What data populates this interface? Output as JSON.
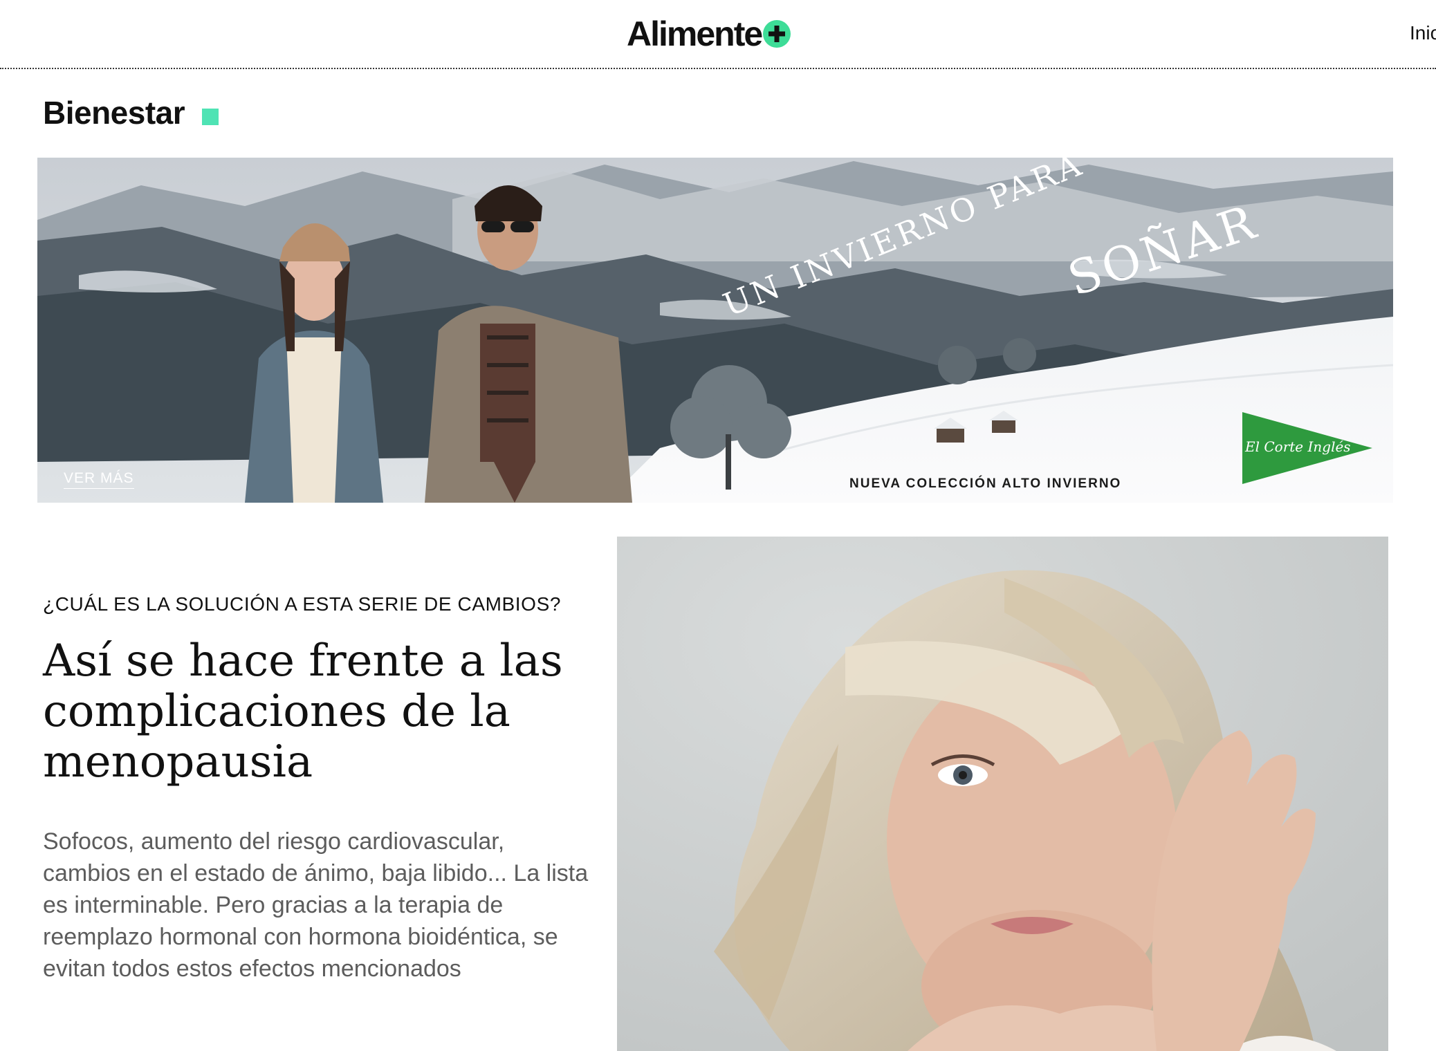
{
  "header": {
    "logo_text": "Alimente",
    "logo_symbol": "plus-circle-icon",
    "nav_partial": "Inic",
    "accent_color": "#3ddc97"
  },
  "section": {
    "title": "Bienestar",
    "marker_color": "#4fe3b4"
  },
  "banner": {
    "headline_small": "UN INVIERNO PARA",
    "headline_big": "SOÑAR",
    "cta": "VER MÁS",
    "tagline": "NUEVA COLECCIÓN ALTO INVIERNO",
    "brand": "El Corte Inglés",
    "brand_color": "#2e9a3e"
  },
  "article": {
    "kicker": "¿CUÁL ES LA SOLUCIÓN A ESTA SERIE DE CAMBIOS?",
    "headline": "Así se hace frente a las complicaciones de la menopausia",
    "summary": "Sofocos, aumento del riesgo cardiovascular, cambios en el estado de ánimo, baja libido... La lista es interminable. Pero gracias a la terapia de reemplazo hormonal con hormona bioidéntica, se evitan todos estos efectos mencionados"
  }
}
